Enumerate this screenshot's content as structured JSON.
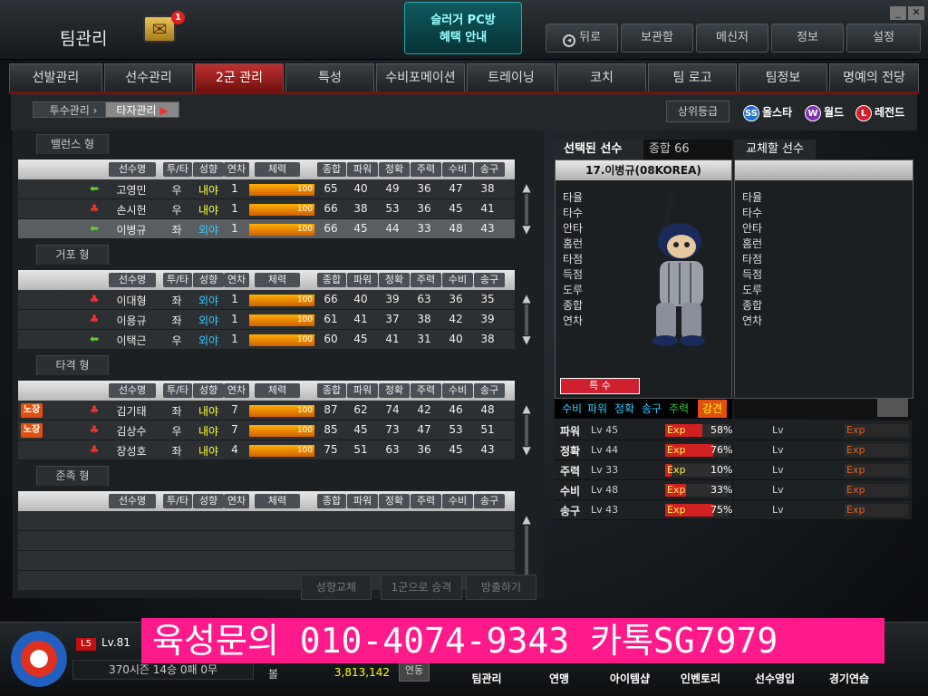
{
  "window": {
    "title": "팀관리",
    "mail_count": "1",
    "promo_line1": "슬러거 PC방",
    "promo_line2": "혜택 안내"
  },
  "nav": [
    {
      "label": "뒤로"
    },
    {
      "label": "보관함"
    },
    {
      "label": "메신저"
    },
    {
      "label": "정보"
    },
    {
      "label": "설정"
    }
  ],
  "tabs": [
    {
      "label": "선발관리"
    },
    {
      "label": "선수관리"
    },
    {
      "label": "2군 관리"
    },
    {
      "label": "특성"
    },
    {
      "label": "수비포메이션"
    },
    {
      "label": "트레이닝"
    },
    {
      "label": "코치"
    },
    {
      "label": "팀 로고"
    },
    {
      "label": "팀정보"
    },
    {
      "label": "명예의 전당"
    }
  ],
  "subtabs": {
    "pitcher": "투수관리",
    "batter": "타자관리"
  },
  "rank": {
    "label": "상위등급",
    "allstar": "올스타",
    "world": "월드",
    "legend": "레전드",
    "ss": "SS",
    "w": "W",
    "l": "L"
  },
  "columns": [
    "선수명",
    "투/타",
    "성향",
    "연차",
    "체력",
    "종합",
    "파워",
    "정확",
    "주력",
    "수비",
    "송구"
  ],
  "groups": [
    {
      "name": "밸런스 형",
      "rows": [
        {
          "cap": "",
          "icon": "arrow",
          "name": "고영민",
          "ht": "우",
          "st": "내야",
          "yr": "1",
          "stamina": "100",
          "ov": "65",
          "pw": "40",
          "ac": "49",
          "sp": "36",
          "df": "47",
          "th": "38"
        },
        {
          "cap": "",
          "icon": "fire",
          "name": "손시헌",
          "ht": "우",
          "st": "내야",
          "yr": "1",
          "stamina": "100",
          "ov": "66",
          "pw": "38",
          "ac": "53",
          "sp": "36",
          "df": "45",
          "th": "41"
        },
        {
          "cap": "",
          "icon": "arrow",
          "name": "이병규",
          "ht": "좌",
          "st": "외야",
          "yr": "1",
          "stamina": "100",
          "ov": "66",
          "pw": "45",
          "ac": "44",
          "sp": "33",
          "df": "48",
          "th": "43"
        }
      ]
    },
    {
      "name": "거포 형",
      "rows": [
        {
          "cap": "",
          "icon": "fire",
          "name": "이대형",
          "ht": "좌",
          "st": "외야",
          "yr": "1",
          "stamina": "100",
          "ov": "66",
          "pw": "40",
          "ac": "39",
          "sp": "63",
          "df": "36",
          "th": "35"
        },
        {
          "cap": "",
          "icon": "fire",
          "name": "이용규",
          "ht": "좌",
          "st": "외야",
          "yr": "1",
          "stamina": "100",
          "ov": "61",
          "pw": "41",
          "ac": "37",
          "sp": "38",
          "df": "42",
          "th": "39"
        },
        {
          "cap": "",
          "icon": "arrow",
          "name": "이택근",
          "ht": "우",
          "st": "외야",
          "yr": "1",
          "stamina": "100",
          "ov": "60",
          "pw": "45",
          "ac": "41",
          "sp": "31",
          "df": "40",
          "th": "38"
        }
      ]
    },
    {
      "name": "타격 형",
      "rows": [
        {
          "cap": "노장",
          "icon": "fire",
          "name": "김기태",
          "ht": "좌",
          "st": "내야",
          "yr": "7",
          "stamina": "100",
          "ov": "87",
          "pw": "62",
          "ac": "74",
          "sp": "42",
          "df": "46",
          "th": "48"
        },
        {
          "cap": "노장",
          "icon": "fire",
          "name": "김상수",
          "ht": "우",
          "st": "내야",
          "yr": "7",
          "stamina": "100",
          "ov": "85",
          "pw": "45",
          "ac": "73",
          "sp": "47",
          "df": "53",
          "th": "51"
        },
        {
          "cap": "",
          "icon": "fire",
          "name": "장성호",
          "ht": "좌",
          "st": "내야",
          "yr": "4",
          "stamina": "100",
          "ov": "75",
          "pw": "51",
          "ac": "63",
          "sp": "36",
          "df": "45",
          "th": "43"
        }
      ]
    },
    {
      "name": "준족 형",
      "rows": []
    }
  ],
  "actions": {
    "change": "성향교체",
    "promote": "1군으로 승격",
    "release": "방출하기"
  },
  "selected": {
    "header": "선택된 선수",
    "overall_label": "종합",
    "overall": "66",
    "player": "17.이병규(08KOREA)",
    "special_btn": "특 수"
  },
  "replace": {
    "header": "교체할 선수"
  },
  "stat_labels": [
    "타율",
    "타수",
    "안타",
    "홈런",
    "타점",
    "득점",
    "도루",
    "종합",
    "연차"
  ],
  "tags": {
    "t1": "수비",
    "t2": "파워",
    "t3": "정확",
    "t4": "송구",
    "t5": "주력",
    "t6": "강견"
  },
  "skills": [
    {
      "name": "파워",
      "lv": "Lv 45",
      "exp": "Exp",
      "pct": "58%",
      "pct_num": 58
    },
    {
      "name": "정확",
      "lv": "Lv 44",
      "exp": "Exp",
      "pct": "76%",
      "pct_num": 76
    },
    {
      "name": "주력",
      "lv": "Lv 33",
      "exp": "Exp",
      "pct": "10%",
      "pct_num": 10
    },
    {
      "name": "수비",
      "lv": "Lv 48",
      "exp": "Exp",
      "pct": "33%",
      "pct_num": 33
    },
    {
      "name": "송구",
      "lv": "Lv 43",
      "exp": "Exp",
      "pct": "75%",
      "pct_num": 75
    }
  ],
  "rep_skill": {
    "lv": "Lv",
    "exp": "Exp"
  },
  "bottom": {
    "level_badge": "L5",
    "level": "Lv.81",
    "season": "370시즌 14승 0패 0무",
    "money_label": "볼",
    "money": "3,813,142",
    "link": "연동",
    "menu": [
      "팀관리",
      "연맹",
      "아이템샵",
      "인벤토리",
      "선수영입",
      "경기연습"
    ]
  },
  "ad": "육성문의 010-4074-9343 카톡SG7979"
}
